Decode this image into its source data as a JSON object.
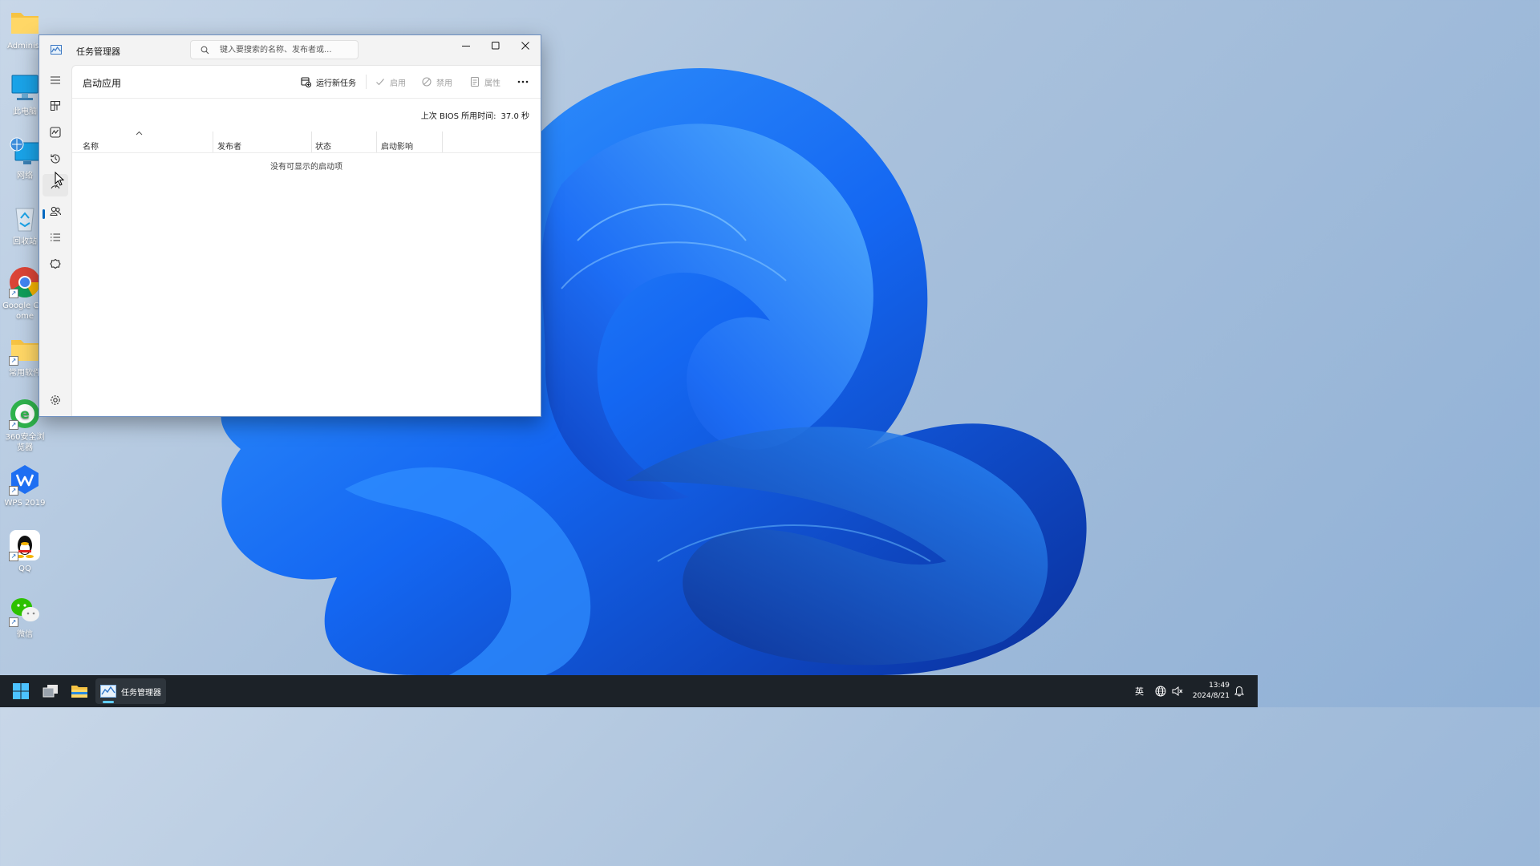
{
  "desktop": {
    "icons": [
      {
        "label": "Administ"
      },
      {
        "label": "此电脑"
      },
      {
        "label": "网络"
      },
      {
        "label": "回收站"
      },
      {
        "label": "Google Chrome"
      },
      {
        "label": "常用软件"
      },
      {
        "label": "360安全浏览器"
      },
      {
        "label": "WPS 2019"
      },
      {
        "label": "QQ"
      },
      {
        "label": "微信"
      }
    ]
  },
  "window": {
    "title": "任务管理器",
    "search": {
      "placeholder": "键入要搜索的名称、发布者或..."
    },
    "nav": [
      {
        "icon": "hamburger-icon"
      },
      {
        "icon": "processes-icon"
      },
      {
        "icon": "performance-icon"
      },
      {
        "icon": "app-history-icon"
      },
      {
        "icon": "startup-apps-icon",
        "active": true
      },
      {
        "icon": "users-icon"
      },
      {
        "icon": "details-icon"
      },
      {
        "icon": "services-icon"
      },
      {
        "icon": "settings-icon"
      }
    ],
    "page_title": "启动应用",
    "toolbar": {
      "run_new_task": "运行新任务",
      "enable": "启用",
      "disable": "禁用",
      "properties": "属性"
    },
    "bios": {
      "label": "上次 BIOS 所用时间:",
      "value": "37.0 秒"
    },
    "columns": [
      "名称",
      "发布者",
      "状态",
      "启动影响"
    ],
    "empty_message": "没有可显示的启动项"
  },
  "taskbar": {
    "active_app_label": "任务管理器",
    "ime": "英",
    "time": "13:49",
    "date": "2024/8/21"
  },
  "colors": {
    "accent": "#0067c0",
    "taskbar": "#1c2228",
    "wallpaper_bloom": "#1a5cf0"
  }
}
